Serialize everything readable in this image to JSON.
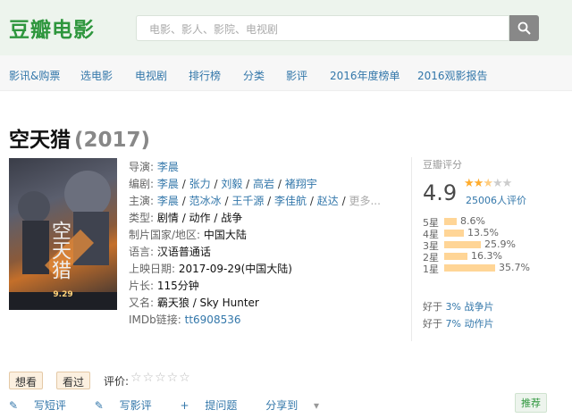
{
  "header": {
    "logo": "豆瓣电影",
    "search_placeholder": "电影、影人、影院、电视剧"
  },
  "nav": [
    "影讯&购票",
    "选电影",
    "电视剧",
    "排行榜",
    "分类",
    "影评",
    "2016年度榜单",
    "2016观影报告"
  ],
  "movie": {
    "title": "空天猎",
    "year": "(2017)",
    "poster_title": "空天猎",
    "poster_date": "9.29",
    "director_label": "导演:",
    "director": "李晨",
    "writer_label": "编剧:",
    "writers": [
      "李晨",
      "张力",
      "刘毅",
      "高岩",
      "褚翔宇"
    ],
    "cast_label": "主演:",
    "cast": [
      "李晨",
      "范冰冰",
      "王千源",
      "李佳航",
      "赵达"
    ],
    "cast_more": "更多...",
    "genre_label": "类型:",
    "genre": "剧情 / 动作 / 战争",
    "country_label": "制片国家/地区:",
    "country": "中国大陆",
    "language_label": "语言:",
    "language": "汉语普通话",
    "release_label": "上映日期:",
    "release": "2017-09-29(中国大陆)",
    "runtime_label": "片长:",
    "runtime": "115分钟",
    "aka_label": "又名:",
    "aka": "霸天狼 / Sky Hunter",
    "imdb_label": "IMDb链接:",
    "imdb": "tt6908536"
  },
  "rating": {
    "label": "豆瓣评分",
    "score": "4.9",
    "stars_filled": "★★",
    "stars_half": "★",
    "stars_empty": "★★",
    "votes": "25006人评价",
    "breakdown": [
      {
        "label": "5星",
        "pct": "8.6%",
        "value": 8.6
      },
      {
        "label": "4星",
        "pct": "13.5%",
        "value": 13.5
      },
      {
        "label": "3星",
        "pct": "25.9%",
        "value": 25.9
      },
      {
        "label": "2星",
        "pct": "16.3%",
        "value": 16.3
      },
      {
        "label": "1星",
        "pct": "35.7%",
        "value": 35.7
      }
    ],
    "better1_prefix": "好于",
    "better1_value": "3% 战争片",
    "better2_prefix": "好于",
    "better2_value": "7% 动作片"
  },
  "actions": {
    "want": "想看",
    "seen": "看过",
    "rate_label": "评价:",
    "rate_stars": "☆☆☆☆☆",
    "short_review": "写短评",
    "review": "写影评",
    "question": "提问题",
    "share": "分享到",
    "recommend": "推荐"
  }
}
